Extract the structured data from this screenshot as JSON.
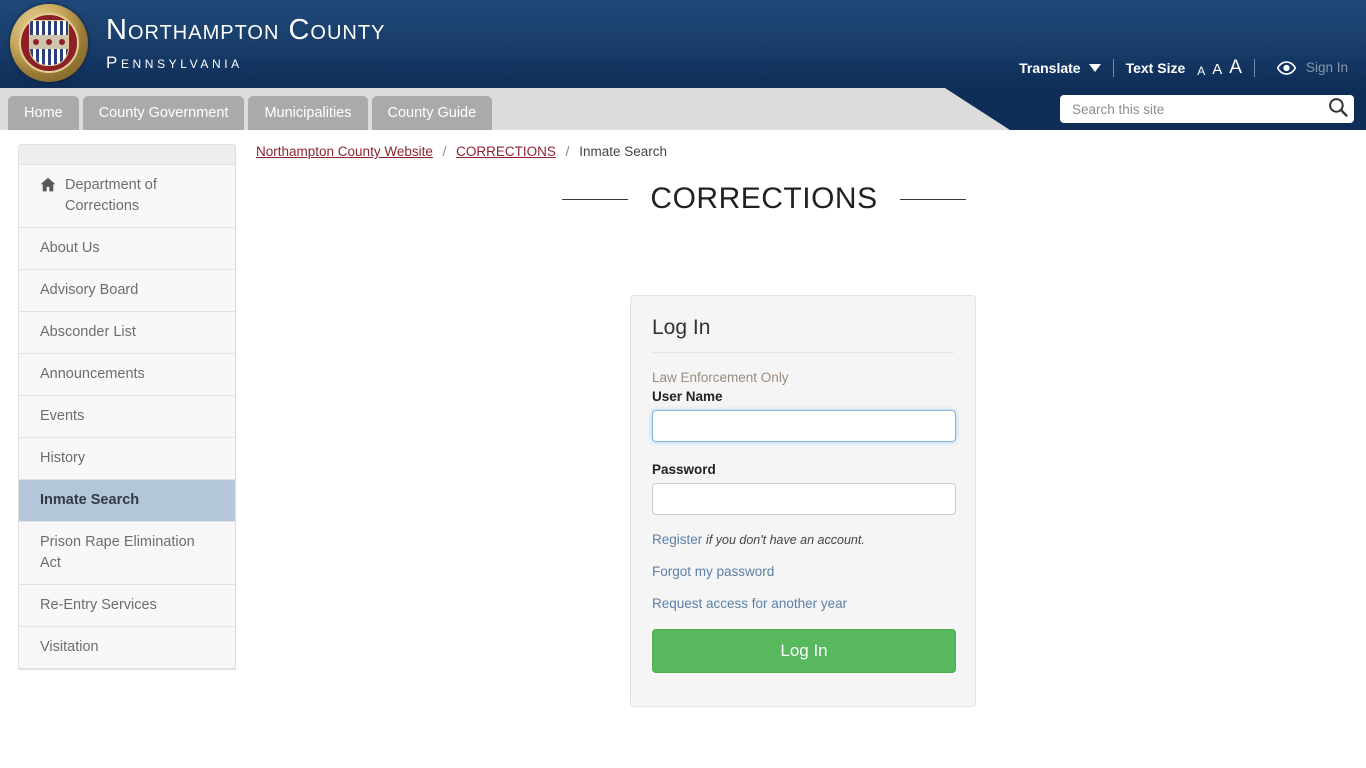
{
  "header": {
    "seal_icon": "county-seal-icon",
    "title_line1": "Northampton County",
    "title_line2": "Pennsylvania",
    "utility": {
      "translate_label": "Translate",
      "translate_caret_icon": "chevron-down-icon",
      "text_size_label": "Text Size",
      "size_small": "A",
      "size_medium": "A",
      "size_large": "A",
      "accessibility_icon": "eye-icon",
      "sign_in_label": "Sign In"
    }
  },
  "nav": {
    "tabs": [
      {
        "label": "Home"
      },
      {
        "label": "County Government"
      },
      {
        "label": "Municipalities"
      },
      {
        "label": "County Guide"
      }
    ],
    "search": {
      "placeholder": "Search this site",
      "value": "",
      "icon": "search-icon"
    }
  },
  "sidebar": {
    "items": [
      {
        "label": "Department of Corrections",
        "icon": "home-icon",
        "active": false
      },
      {
        "label": "About Us",
        "active": false
      },
      {
        "label": "Advisory Board",
        "active": false
      },
      {
        "label": "Absconder List",
        "active": false
      },
      {
        "label": "Announcements",
        "active": false
      },
      {
        "label": "Events",
        "active": false
      },
      {
        "label": "History",
        "active": false
      },
      {
        "label": "Inmate Search",
        "active": true
      },
      {
        "label": "Prison Rape Elimination Act",
        "active": false
      },
      {
        "label": "Re-Entry Services",
        "active": false
      },
      {
        "label": "Visitation",
        "active": false
      }
    ]
  },
  "breadcrumb": {
    "items": [
      {
        "label": "Northampton County Website",
        "link": true
      },
      {
        "label": "CORRECTIONS",
        "link": true
      },
      {
        "label": "Inmate Search",
        "link": false
      }
    ],
    "separator": "/"
  },
  "main": {
    "page_title": "CORRECTIONS",
    "login": {
      "heading": "Log In",
      "notice": "Law Enforcement Only",
      "username_label": "User Name",
      "username_value": "",
      "password_label": "Password",
      "password_value": "",
      "register_link": "Register",
      "register_note": "if you don't have an account.",
      "forgot_link": "Forgot my password",
      "request_link": "Request access for another year",
      "submit_label": "Log In"
    }
  },
  "colors": {
    "header_blue_top": "#1f4879",
    "header_blue_bottom": "#0e2d57",
    "nav_band_gray": "#dcdcdc",
    "nav_tab_gray": "#aaaaaa",
    "breadcrumb_link": "#8c2430",
    "sidebar_active_bg": "#b4c6d9",
    "card_bg": "#f5f5f5",
    "login_button_green": "#57b85d",
    "link_blue": "#5b7fa6"
  }
}
